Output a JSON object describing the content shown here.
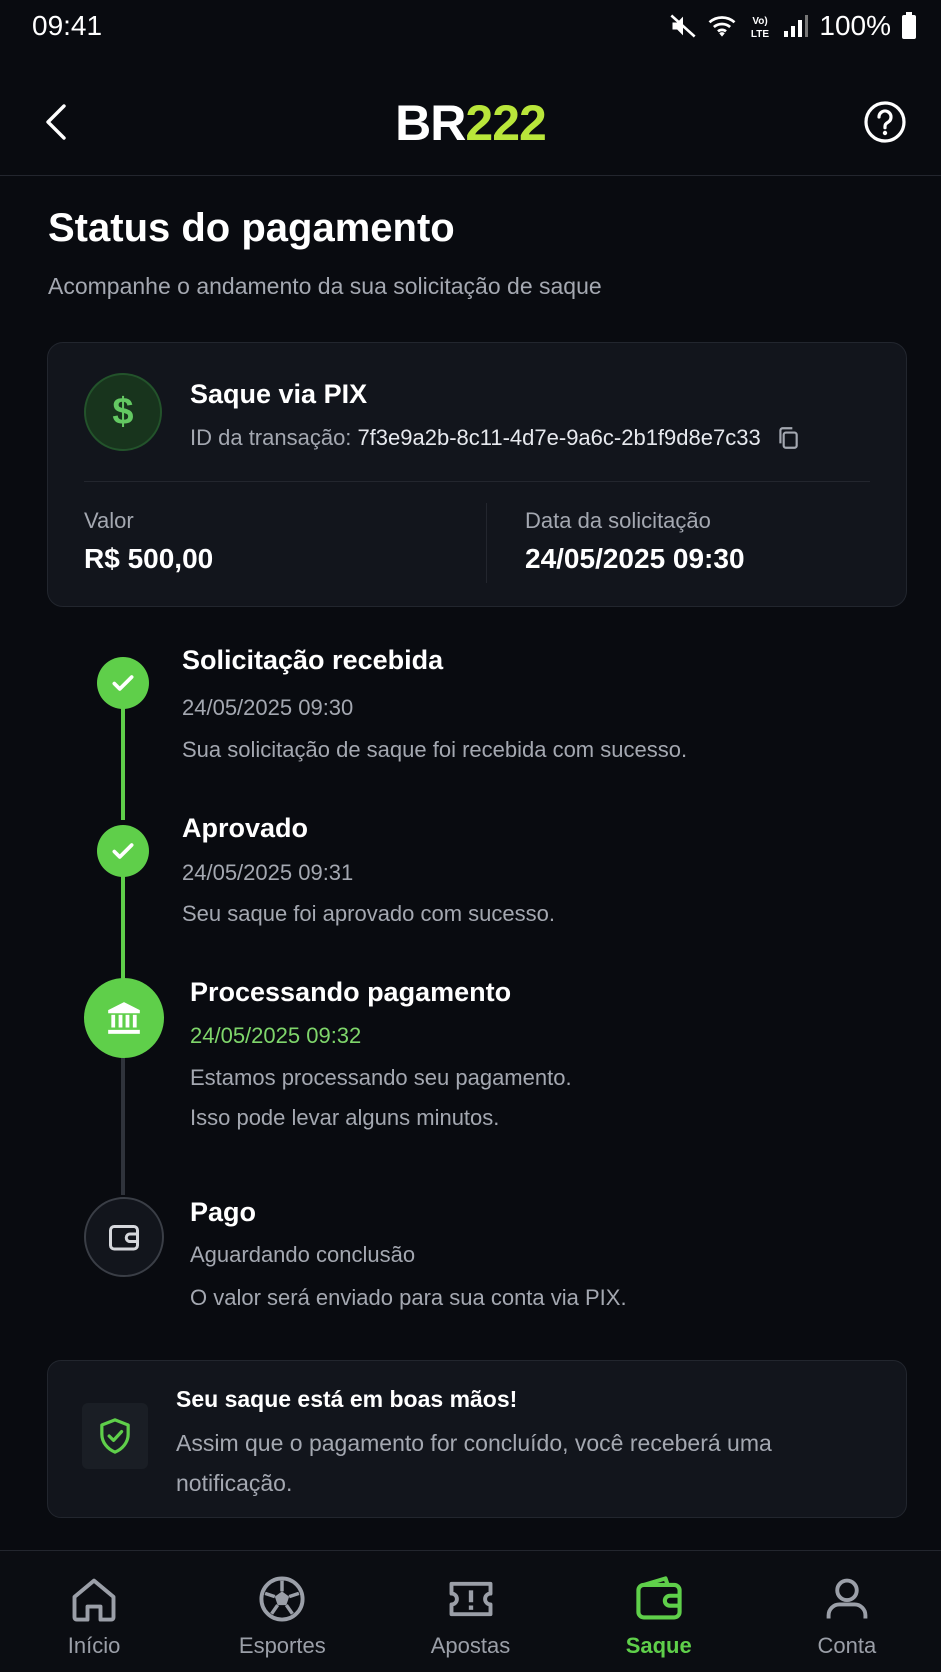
{
  "status_bar": {
    "time": "09:41",
    "network_badge_top": "Vo)",
    "network_badge_bottom": "LTE",
    "battery": "100%"
  },
  "header": {
    "logo_letters": "BR",
    "logo_number": "222"
  },
  "page": {
    "title": "Status do pagamento",
    "subtitle": "Acompanhe o andamento da sua solicitação de saque"
  },
  "transaction": {
    "icon_symbol": "$",
    "title": "Saque via PIX",
    "id_label": "ID da transação:",
    "id_value": "7f3e9a2b-8c11-4d7e-9a6c-2b1f9d8e7c33",
    "amount_label": "Valor",
    "amount_value": "R$ 500,00",
    "date_label": "Data da solicitação",
    "date_value": "24/05/2025 09:30"
  },
  "timeline": [
    {
      "title": "Solicitação recebida",
      "date": "24/05/2025 09:30",
      "desc": [
        "Sua solicitação de saque foi recebida com sucesso."
      ],
      "state": "done",
      "icon": "check-icon"
    },
    {
      "title": "Aprovado",
      "date": "24/05/2025 09:31",
      "desc": [
        "Seu saque foi aprovado com sucesso."
      ],
      "state": "done",
      "icon": "check-icon"
    },
    {
      "title": "Processando pagamento",
      "date": "24/05/2025 09:32",
      "desc": [
        "Estamos processando seu pagamento.",
        "Isso pode levar alguns minutos."
      ],
      "state": "active",
      "icon": "bank-icon"
    },
    {
      "title": "Pago",
      "date": "Aguardando conclusão",
      "desc": [
        "O valor será enviado para sua conta via PIX."
      ],
      "state": "pending",
      "icon": "wallet-icon"
    }
  ],
  "info": {
    "title": "Seu saque está em boas mãos!",
    "text": "Assim que o pagamento for concluído, você receberá uma notificação."
  },
  "nav": [
    {
      "label": "Início",
      "icon": "home-icon",
      "active": false
    },
    {
      "label": "Esportes",
      "icon": "soccer-ball-icon",
      "active": false
    },
    {
      "label": "Apostas",
      "icon": "ticket-icon",
      "active": false
    },
    {
      "label": "Saque",
      "icon": "wallet-icon",
      "active": true
    },
    {
      "label": "Conta",
      "icon": "user-icon",
      "active": false
    }
  ],
  "colors": {
    "background": "#090b10",
    "card": "#12151c",
    "accent_green": "#5fcf4a",
    "logo_accent": "#b9e63a",
    "muted_text": "#a4a8b1"
  }
}
